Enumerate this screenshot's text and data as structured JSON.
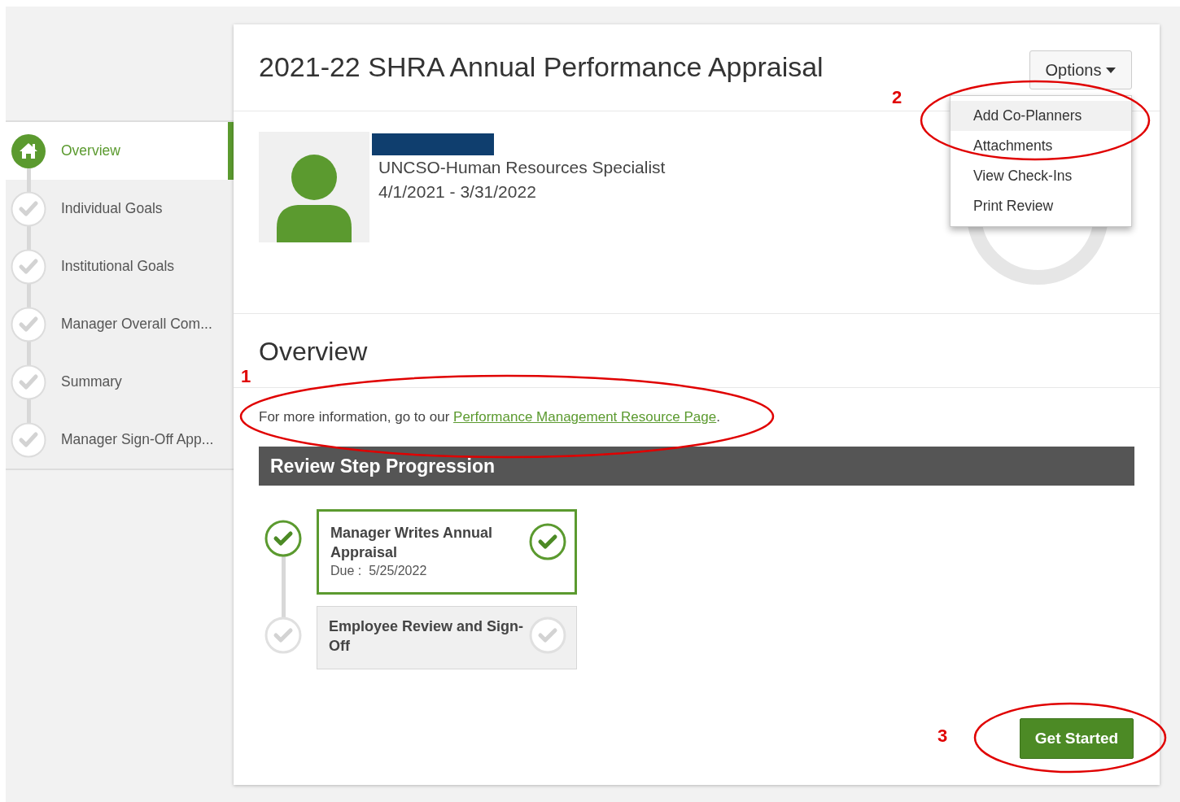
{
  "sidebar": {
    "items": [
      {
        "label": "Overview",
        "kind": "home",
        "selected": true
      },
      {
        "label": "Individual Goals",
        "kind": "check",
        "selected": false
      },
      {
        "label": "Institutional Goals",
        "kind": "check",
        "selected": false
      },
      {
        "label": "Manager Overall Com...",
        "kind": "check",
        "selected": false
      },
      {
        "label": "Summary",
        "kind": "check",
        "selected": false
      },
      {
        "label": "Manager Sign-Off App...",
        "kind": "check",
        "selected": false
      }
    ]
  },
  "header": {
    "title": "2021-22 SHRA Annual Performance Appraisal",
    "options_button": "Options"
  },
  "options_menu": [
    {
      "label": "Add Co-Planners",
      "selected": true
    },
    {
      "label": "Attachments",
      "selected": false
    },
    {
      "label": "View Check-Ins",
      "selected": false
    },
    {
      "label": "Print Review",
      "selected": false
    }
  ],
  "profile": {
    "job_title": "UNCSO-Human Resources Specialist",
    "period": "4/1/2021 - 3/31/2022"
  },
  "overview": {
    "heading": "Overview",
    "info_text": "For more information, go to our ",
    "link": "Performance Management Resource Page",
    "after_link": "."
  },
  "progression": {
    "heading": "Review Step Progression",
    "steps": [
      {
        "title": "Manager Writes Annual Appraisal",
        "due_label": "Due :",
        "due_date": "5/25/2022",
        "completed": true
      },
      {
        "title": "Employee Review and Sign-Off",
        "completed": false
      }
    ]
  },
  "get_started_button": "Get Started",
  "annotations": [
    {
      "label": "1"
    },
    {
      "label": "2"
    },
    {
      "label": "3"
    }
  ]
}
